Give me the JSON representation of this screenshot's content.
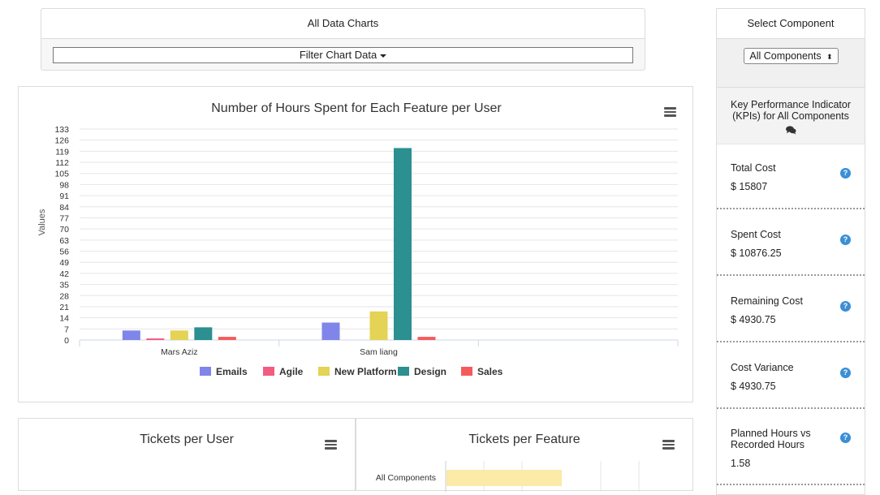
{
  "filter": {
    "title": "All Data Charts",
    "button_label": "Filter Chart Data"
  },
  "sidebar": {
    "header": "Select Component",
    "select_value": "All Components",
    "kpi_title_line1": "Key Performance Indicator",
    "kpi_title_line2": "(KPIs) for All Components",
    "kpis": [
      {
        "label": "Total Cost",
        "value": "$ 15807"
      },
      {
        "label": "Spent Cost",
        "value": "$ 10876.25"
      },
      {
        "label": "Remaining Cost",
        "value": "$ 4930.75"
      },
      {
        "label": "Cost Variance",
        "value": "$ 4930.75"
      },
      {
        "label": "Planned Hours vs Recorded Hours",
        "value": "1.58"
      }
    ],
    "help_glyph": "?"
  },
  "chart_data": [
    {
      "type": "bar",
      "title": "Number of Hours Spent for Each Feature per User",
      "ylabel": "Values",
      "ylim": [
        0,
        133
      ],
      "yticks": [
        0,
        7,
        14,
        21,
        28,
        35,
        42,
        49,
        56,
        63,
        70,
        77,
        84,
        91,
        98,
        105,
        112,
        119,
        126,
        133
      ],
      "categories": [
        "Mars Aziz",
        "Sam liang"
      ],
      "slots": 3,
      "legend_position": "bottom",
      "grid": true,
      "series": [
        {
          "name": "Emails",
          "color": "#8085e9",
          "values": [
            6,
            11
          ]
        },
        {
          "name": "Agile",
          "color": "#f15c80",
          "values": [
            1,
            0
          ]
        },
        {
          "name": "New Platform",
          "color": "#e4d354",
          "values": [
            6,
            18
          ]
        },
        {
          "name": "Design",
          "color": "#2b908f",
          "values": [
            8,
            121
          ]
        },
        {
          "name": "Sales",
          "color": "#f45b5b",
          "values": [
            2,
            2
          ]
        }
      ]
    },
    {
      "type": "bar",
      "title": "Tickets per User"
    },
    {
      "type": "bar",
      "title": "Tickets per Feature",
      "categories": [
        "All Components"
      ]
    }
  ],
  "icons": {
    "menu": "menu-icon",
    "help": "help-icon",
    "comments": "comments-icon",
    "caret": "caret-down-icon"
  }
}
